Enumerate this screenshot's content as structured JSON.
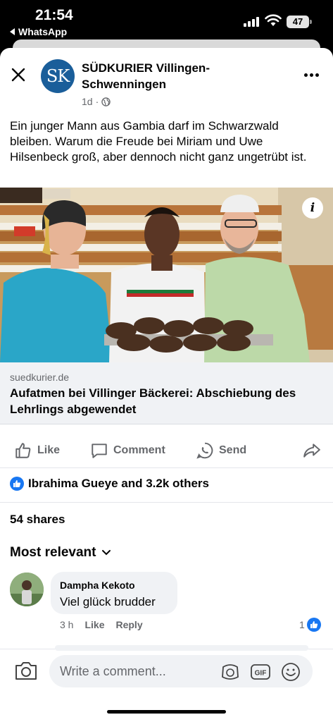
{
  "status_bar": {
    "time": "21:54",
    "back_app": "WhatsApp",
    "battery": "47"
  },
  "post": {
    "page_name": "SÜDKURIER Villingen-Schwenningen",
    "avatar_text": "SK",
    "avatar_color": "#1a5e9a",
    "age": "1d",
    "text": "Ein junger Mann aus Gambia darf im Schwarzwald bleiben. Warum die Freude bei Miriam und Uwe Hilsenbeck groß, aber dennoch nicht ganz ungetrübt ist.",
    "link_domain": "suedkurier.de",
    "link_title": "Aufatmen bei Villinger Bäckerei: Abschiebung des Lehrlings abgewendet"
  },
  "actions": {
    "like": "Like",
    "comment": "Comment",
    "send": "Send"
  },
  "reactions": {
    "summary": "Ibrahima Gueye and 3.2k others",
    "shares": "54 shares"
  },
  "comments": {
    "sort_label": "Most relevant",
    "items": [
      {
        "author": "Dampha Kekoto",
        "text": "Viel glück brudder",
        "time": "3 h",
        "like": "Like",
        "reply": "Reply",
        "likes": "1"
      }
    ]
  },
  "composer": {
    "placeholder": "Write a comment..."
  },
  "colors": {
    "fb_blue": "#1877f2",
    "meta_gray": "#65676b"
  }
}
